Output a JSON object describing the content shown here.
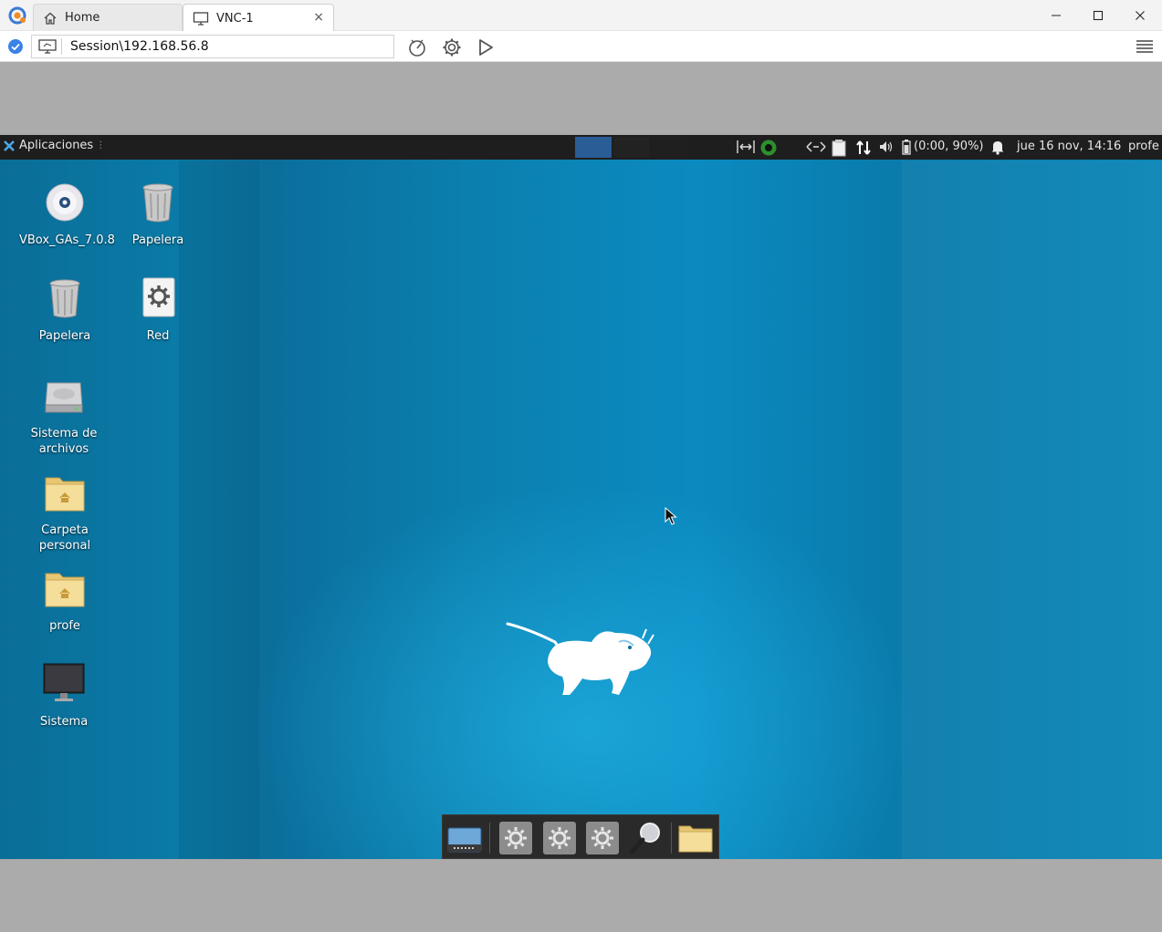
{
  "window": {
    "tabs": [
      {
        "label": "Home",
        "icon": "home-icon"
      },
      {
        "label": "VNC-1",
        "icon": "monitor-icon",
        "close": "×"
      }
    ],
    "controls": {
      "minimize": "minimize-icon",
      "maximize": "maximize-icon",
      "close": "close-icon"
    }
  },
  "addressbar": {
    "session": "Session\\192.168.56.8",
    "tools": [
      "connection-speed-icon",
      "settings-gear-icon",
      "play-icon"
    ],
    "menu": "hamburger-menu-icon"
  },
  "remote": {
    "panel": {
      "apps_label": "Aplicaciones",
      "battery": "(0:00, 90%)",
      "clock": "jue 16 nov, 14:16",
      "user": "profe"
    },
    "desktop_icons": [
      {
        "label": "VBox_GAs_7.0.8",
        "icon": "optical-disc-icon"
      },
      {
        "label": "Papelera",
        "icon": "trash-icon"
      },
      {
        "label": "Papelera",
        "icon": "trash-icon"
      },
      {
        "label": "Red",
        "icon": "network-gear-icon"
      },
      {
        "label": "Sistema de archivos",
        "icon": "hard-drive-icon"
      },
      {
        "label": "Carpeta personal",
        "icon": "home-folder-icon"
      },
      {
        "label": "profe",
        "icon": "home-folder-icon"
      },
      {
        "label": "Sistema",
        "icon": "monitor-icon"
      }
    ],
    "dock": [
      "show-desktop-icon",
      "settings-gear-icon",
      "settings-gear-icon",
      "settings-gear-icon",
      "search-magnifier-icon",
      "folder-icon"
    ]
  },
  "colors": {
    "accent": "#2a5d96",
    "desktop": "#0b7fae",
    "panel": "#1e1e1e"
  }
}
